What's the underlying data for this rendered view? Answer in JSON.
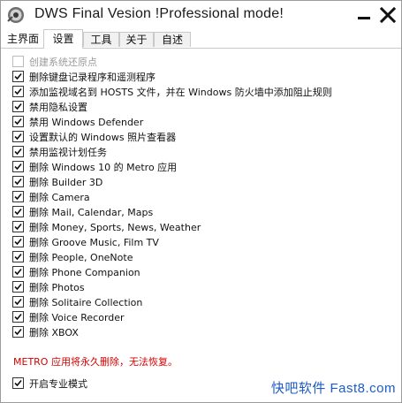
{
  "window": {
    "title": "DWS Final Vesion  !Professional mode!"
  },
  "tabs": [
    {
      "label": "主界面"
    },
    {
      "label": "设置"
    },
    {
      "label": "工具"
    },
    {
      "label": "关于"
    },
    {
      "label": "自述"
    }
  ],
  "options": [
    {
      "label": "创建系统还原点",
      "checked": false,
      "disabled": true
    },
    {
      "label": "删除键盘记录程序和遥测程序",
      "checked": true
    },
    {
      "label": "添加监视域名到 HOSTS 文件，并在 Windows 防火墙中添加阻止规则",
      "checked": true
    },
    {
      "label": "禁用隐私设置",
      "checked": true
    },
    {
      "label": "禁用 Windows Defender",
      "checked": true
    },
    {
      "label": "设置默认的 Windows 照片查看器",
      "checked": true
    },
    {
      "label": "禁用监视计划任务",
      "checked": true
    },
    {
      "label": "删除 Windows 10 的 Metro 应用",
      "checked": true
    },
    {
      "label": "删除 Builder 3D",
      "checked": true
    },
    {
      "label": "删除 Camera",
      "checked": true
    },
    {
      "label": "删除 Mail, Calendar, Maps",
      "checked": true
    },
    {
      "label": "删除 Money, Sports, News, Weather",
      "checked": true
    },
    {
      "label": "删除 Groove Music, Film TV",
      "checked": true
    },
    {
      "label": "删除 People, OneNote",
      "checked": true
    },
    {
      "label": "删除 Phone Companion",
      "checked": true
    },
    {
      "label": "删除 Photos",
      "checked": true
    },
    {
      "label": "删除 Solitaire Collection",
      "checked": true
    },
    {
      "label": "删除 Voice Recorder",
      "checked": true
    },
    {
      "label": "删除 XBOX",
      "checked": true
    }
  ],
  "warning": "METRO 应用将永久删除，无法恢复。",
  "pro_mode": {
    "label": "开启专业模式",
    "checked": true
  },
  "watermark": "快吧软件 Fast8.com",
  "colors": {
    "warning": "#d40000",
    "watermark": "#1d5cc5"
  }
}
